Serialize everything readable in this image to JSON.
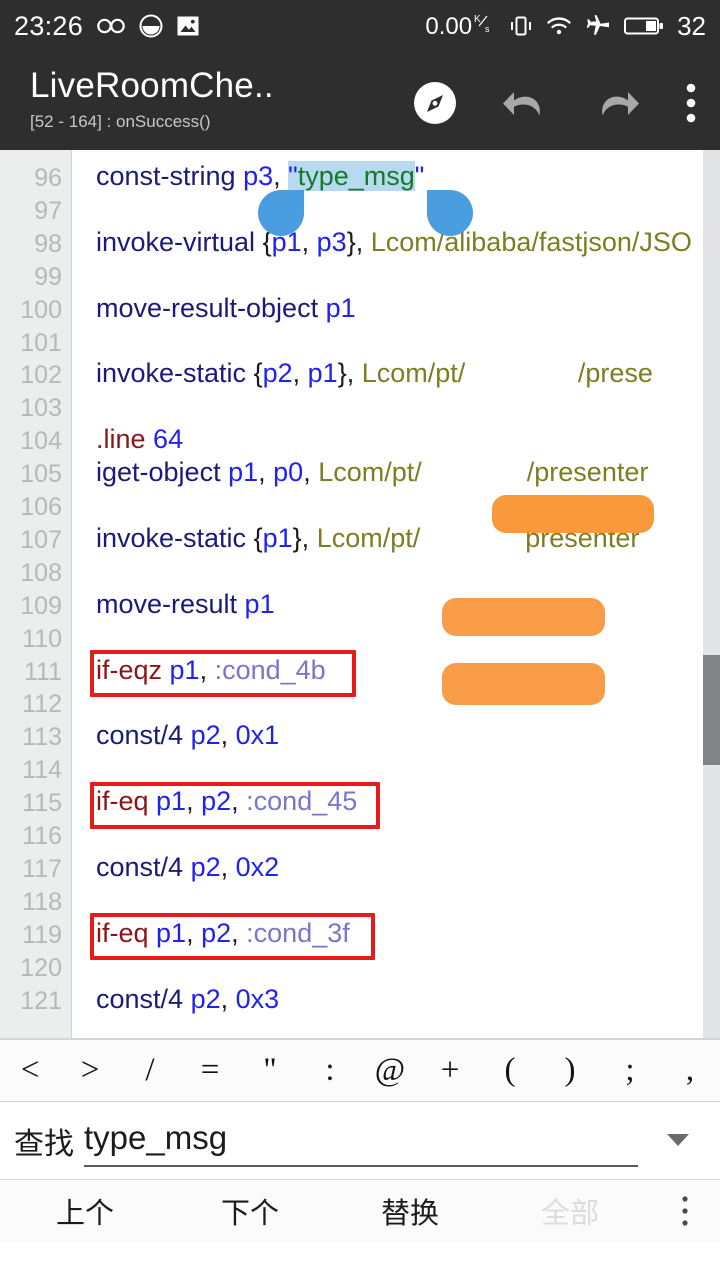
{
  "status_bar": {
    "clock": "23:26",
    "icons_left": [
      "infinity-icon",
      "circle-half-icon",
      "photo-icon"
    ],
    "net_speed": "0.00",
    "net_speed_unit_top": "K",
    "net_speed_unit_bottom": "s",
    "icons_right": [
      "vibrate-icon",
      "wifi-icon",
      "airplane-mode-icon",
      "battery-icon"
    ],
    "battery_level": "32"
  },
  "app_bar": {
    "title": "LiveRoomChe..",
    "subtitle": "[52 - 164] : onSuccess()",
    "actions": [
      "navigate-icon",
      "undo-icon",
      "redo-icon",
      "overflow-menu-icon"
    ]
  },
  "editor": {
    "lines": [
      {
        "num": "96",
        "tokens": [
          {
            "t": "const-string ",
            "c": "op"
          },
          {
            "t": "p3",
            "c": "reg"
          },
          {
            "t": ", ",
            "c": "punc"
          },
          {
            "t": "\"",
            "c": "quote sel"
          },
          {
            "t": "type_msg",
            "c": "str sel"
          },
          {
            "t": "\"",
            "c": "quote"
          }
        ]
      },
      {
        "num": "97",
        "tokens": []
      },
      {
        "num": "98",
        "tokens": [
          {
            "t": "invoke-virtual ",
            "c": "op"
          },
          {
            "t": "{",
            "c": "punc"
          },
          {
            "t": "p1",
            "c": "reg"
          },
          {
            "t": ", ",
            "c": "punc"
          },
          {
            "t": "p3",
            "c": "reg"
          },
          {
            "t": "}",
            "c": "punc"
          },
          {
            "t": ", ",
            "c": "punc"
          },
          {
            "t": "Lcom/alibaba/fastjson/JSO",
            "c": "type"
          }
        ]
      },
      {
        "num": "99",
        "tokens": []
      },
      {
        "num": "100",
        "tokens": [
          {
            "t": "move-result-object ",
            "c": "op"
          },
          {
            "t": "p1",
            "c": "reg"
          }
        ]
      },
      {
        "num": "101",
        "tokens": []
      },
      {
        "num": "102",
        "tokens": [
          {
            "t": "invoke-static ",
            "c": "op"
          },
          {
            "t": "{",
            "c": "punc"
          },
          {
            "t": "p2",
            "c": "reg"
          },
          {
            "t": ", ",
            "c": "punc"
          },
          {
            "t": "p1",
            "c": "reg"
          },
          {
            "t": "}",
            "c": "punc"
          },
          {
            "t": ", ",
            "c": "punc"
          },
          {
            "t": "Lcom/pt/",
            "c": "type"
          },
          {
            "t": "               ",
            "c": "type"
          },
          {
            "t": "/prese",
            "c": "type"
          }
        ]
      },
      {
        "num": "103",
        "tokens": []
      },
      {
        "num": "104",
        "tokens": [
          {
            "t": ".line ",
            "c": "opred"
          },
          {
            "t": "64",
            "c": "num"
          }
        ]
      },
      {
        "num": "105",
        "tokens": [
          {
            "t": "iget-object ",
            "c": "op"
          },
          {
            "t": "p1",
            "c": "reg"
          },
          {
            "t": ", ",
            "c": "punc"
          },
          {
            "t": "p0",
            "c": "reg"
          },
          {
            "t": ", ",
            "c": "punc"
          },
          {
            "t": "Lcom/pt/",
            "c": "type"
          },
          {
            "t": "              ",
            "c": "type"
          },
          {
            "t": "/presenter",
            "c": "type"
          }
        ]
      },
      {
        "num": "106",
        "tokens": []
      },
      {
        "num": "107",
        "tokens": [
          {
            "t": "invoke-static ",
            "c": "op"
          },
          {
            "t": "{",
            "c": "punc"
          },
          {
            "t": "p1",
            "c": "reg"
          },
          {
            "t": "}",
            "c": "punc"
          },
          {
            "t": ", ",
            "c": "punc"
          },
          {
            "t": "Lcom/pt/",
            "c": "type"
          },
          {
            "t": "              ",
            "c": "type"
          },
          {
            "t": "presenter",
            "c": "type"
          }
        ]
      },
      {
        "num": "108",
        "tokens": []
      },
      {
        "num": "109",
        "tokens": [
          {
            "t": "move-result ",
            "c": "op"
          },
          {
            "t": "p1",
            "c": "reg"
          }
        ]
      },
      {
        "num": "110",
        "tokens": []
      },
      {
        "num": "111",
        "tokens": [
          {
            "t": "if-eqz ",
            "c": "opred"
          },
          {
            "t": "p1",
            "c": "reg"
          },
          {
            "t": ", ",
            "c": "punc"
          },
          {
            "t": ":cond_4b",
            "c": "label"
          }
        ]
      },
      {
        "num": "112",
        "tokens": []
      },
      {
        "num": "113",
        "tokens": [
          {
            "t": "const/4 ",
            "c": "op"
          },
          {
            "t": "p2",
            "c": "reg"
          },
          {
            "t": ", ",
            "c": "punc"
          },
          {
            "t": "0x1",
            "c": "num"
          }
        ]
      },
      {
        "num": "114",
        "tokens": []
      },
      {
        "num": "115",
        "tokens": [
          {
            "t": "if-eq ",
            "c": "opred"
          },
          {
            "t": "p1",
            "c": "reg"
          },
          {
            "t": ", ",
            "c": "punc"
          },
          {
            "t": "p2",
            "c": "reg"
          },
          {
            "t": ", ",
            "c": "punc"
          },
          {
            "t": ":cond_45",
            "c": "label"
          }
        ]
      },
      {
        "num": "116",
        "tokens": []
      },
      {
        "num": "117",
        "tokens": [
          {
            "t": "const/4 ",
            "c": "op"
          },
          {
            "t": "p2",
            "c": "reg"
          },
          {
            "t": ", ",
            "c": "punc"
          },
          {
            "t": "0x2",
            "c": "num"
          }
        ]
      },
      {
        "num": "118",
        "tokens": []
      },
      {
        "num": "119",
        "tokens": [
          {
            "t": "if-eq ",
            "c": "opred"
          },
          {
            "t": "p1",
            "c": "reg"
          },
          {
            "t": ", ",
            "c": "punc"
          },
          {
            "t": "p2",
            "c": "reg"
          },
          {
            "t": ", ",
            "c": "punc"
          },
          {
            "t": ":cond_3f",
            "c": "label"
          }
        ]
      },
      {
        "num": "120",
        "tokens": []
      },
      {
        "num": "121",
        "tokens": [
          {
            "t": "const/4 ",
            "c": "op"
          },
          {
            "t": "p2",
            "c": "reg"
          },
          {
            "t": ", ",
            "c": "punc"
          },
          {
            "t": "0x3",
            "c": "num"
          }
        ]
      }
    ],
    "annotation_boxes": [
      {
        "name": "red-box-cond-4b",
        "line": "111"
      },
      {
        "name": "red-box-cond-45",
        "line": "115"
      },
      {
        "name": "red-box-cond-3f",
        "line": "119"
      }
    ],
    "redactions": [
      {
        "name": "orange-redaction-line-102"
      },
      {
        "name": "orange-redaction-line-105"
      },
      {
        "name": "orange-redaction-line-107"
      }
    ],
    "selection": {
      "text": "type_msg",
      "highlight_color": "#b8d9f2",
      "handle_color": "#4a9ee0"
    },
    "scrollbar": {
      "visible": true
    }
  },
  "symbol_bar": {
    "symbols": [
      "<",
      ">",
      "/",
      "=",
      "\"",
      ":",
      "@",
      "+",
      "(",
      ")",
      ";",
      ","
    ]
  },
  "search": {
    "label": "查找",
    "value": "type_msg",
    "placeholder": "",
    "dropdown_icon": "chevron-down-icon"
  },
  "action_bar": {
    "prev": "上个",
    "next": "下个",
    "replace": "替换",
    "all": "全部",
    "all_disabled": true,
    "overflow_icon": "overflow-menu-icon"
  },
  "colors": {
    "chrome": "#2e2e2e",
    "accent_selection": "#b8d9f2",
    "annotation_red": "#e81b1b",
    "redaction_orange": "#f7922d",
    "gutter": "#eceded"
  }
}
